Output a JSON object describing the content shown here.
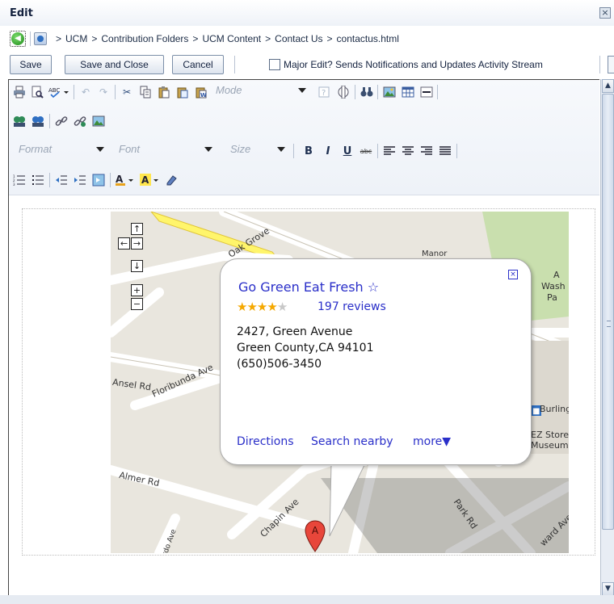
{
  "window": {
    "title": "Edit",
    "close_icon": "×"
  },
  "breadcrumb": {
    "back_icon": "back-arrow-icon",
    "site_icon": "site-icon",
    "items": [
      "UCM",
      "Contribution Folders",
      "UCM Content",
      "Contact Us",
      "contactus.html"
    ],
    "separator": ">"
  },
  "actions": {
    "save": "Save",
    "save_close": "Save and Close",
    "cancel": "Cancel",
    "major_edit_label": "Major Edit? Sends Notifications and Updates Activity Stream",
    "major_edit_checked": false
  },
  "toolbar": {
    "mode_placeholder": "Mode",
    "format_placeholder": "Format",
    "font_placeholder": "Font",
    "size_placeholder": "Size",
    "bold": "B",
    "italic": "I",
    "underline": "U",
    "strike": "abc"
  },
  "map": {
    "streets": [
      "Oak Grove",
      "Manor",
      "Ansel Rd",
      "Floribunda Ave",
      "Almer Rd",
      "Chapin Ave",
      "Park Rd",
      "ward Ave",
      "Burling",
      "EZ Store",
      "Museum",
      "Wash",
      "Pa",
      "A",
      "rdo Ave"
    ],
    "marker_label": "A",
    "pan_up": "↑",
    "pan_left": "←",
    "pan_right": "→",
    "pan_down": "↓",
    "zoom_in": "+",
    "zoom_out": "−"
  },
  "place": {
    "name": "Go Green Eat Fresh",
    "rating": 4,
    "rating_max": 5,
    "reviews": "197 reviews",
    "address_line1": "2427, Green Avenue",
    "address_line2": "Green County,CA 94101",
    "phone": "(650)506-3450",
    "links": {
      "directions": "Directions",
      "search": "Search nearby",
      "more": "more▼"
    }
  },
  "colors": {
    "link": "#2a2fc9",
    "star": "#f5a800",
    "road_major": "#fff56b",
    "park": "#c9dfae"
  }
}
